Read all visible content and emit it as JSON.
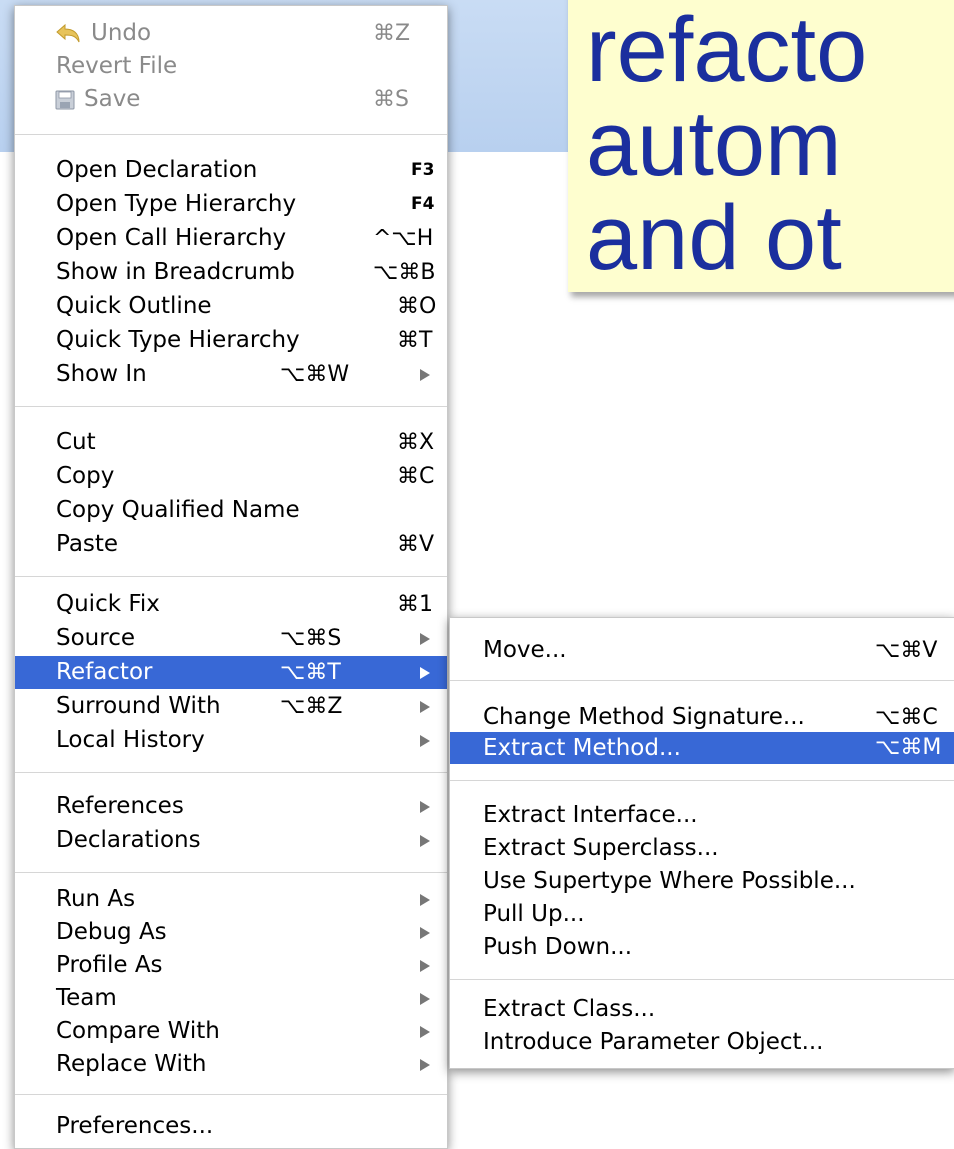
{
  "callout": {
    "lines": [
      "refacto",
      "autom",
      "and ot"
    ]
  },
  "main_menu": {
    "undo": "Undo",
    "undo_key": "⌘Z",
    "revert_file": "Revert File",
    "save": "Save",
    "save_key": "⌘S",
    "open_declaration": "Open Declaration",
    "open_declaration_key": "F3",
    "open_type_hierarchy": "Open Type Hierarchy",
    "open_type_hierarchy_key": "F4",
    "open_call_hierarchy": "Open Call Hierarchy",
    "open_call_hierarchy_key": "^⌥H",
    "show_in_breadcrumb": "Show in Breadcrumb",
    "show_in_breadcrumb_key": "⌥⌘B",
    "quick_outline": "Quick Outline",
    "quick_outline_key": "⌘O",
    "quick_type_hierarchy": "Quick Type Hierarchy",
    "quick_type_hierarchy_key": "⌘T",
    "show_in": "Show In",
    "show_in_key": "⌥⌘W",
    "cut": "Cut",
    "cut_key": "⌘X",
    "copy": "Copy",
    "copy_key": "⌘C",
    "copy_qualified_name": "Copy Qualified Name",
    "paste": "Paste",
    "paste_key": "⌘V",
    "quick_fix": "Quick Fix",
    "quick_fix_key": "⌘1",
    "source": "Source",
    "source_key": "⌥⌘S",
    "refactor": "Refactor",
    "refactor_key": "⌥⌘T",
    "surround_with": "Surround With",
    "surround_with_key": "⌥⌘Z",
    "local_history": "Local History",
    "references": "References",
    "declarations": "Declarations",
    "run_as": "Run As",
    "debug_as": "Debug As",
    "profile_as": "Profile As",
    "team": "Team",
    "compare_with": "Compare With",
    "replace_with": "Replace With",
    "preferences": "Preferences..."
  },
  "submenu": {
    "move": "Move...",
    "move_key": "⌥⌘V",
    "change_method_signature": "Change Method Signature...",
    "change_method_signature_key": "⌥⌘C",
    "extract_method": "Extract Method...",
    "extract_method_key": "⌥⌘M",
    "extract_interface": "Extract Interface...",
    "extract_superclass": "Extract Superclass...",
    "use_supertype": "Use Supertype Where Possible...",
    "pull_up": "Pull Up...",
    "push_down": "Push Down...",
    "extract_class": "Extract Class...",
    "introduce_parameter_object": "Introduce Parameter Object..."
  },
  "icons": {
    "undo": "undo-arrow-icon",
    "save": "floppy-disk-icon",
    "submenu": "submenu-arrow-icon"
  },
  "colors": {
    "selection": "#3868d6",
    "callout_bg": "#fefecf",
    "callout_text": "#1b2f9e",
    "top_band": "#c9dcf4"
  }
}
